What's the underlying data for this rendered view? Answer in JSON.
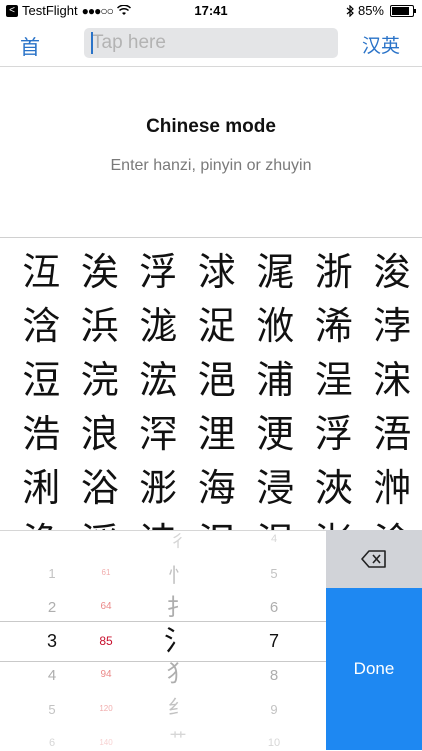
{
  "status_bar": {
    "back_app": "TestFlight",
    "back_glyph": "<",
    "signal": "●●●○○",
    "time": "17:41",
    "battery_text": "85%",
    "battery_level": 0.85
  },
  "nav": {
    "home_label": "首",
    "search_placeholder": "Tap here",
    "lang_label": "汉英"
  },
  "header": {
    "title": "Chinese mode",
    "subtitle": "Enter hanzi, pinyin or zhuyin"
  },
  "char_grid": [
    [
      "沍",
      "涘",
      "浮",
      "浗",
      "浘",
      "浙",
      "浚"
    ],
    [
      "浛",
      "浜",
      "浝",
      "浞",
      "浟",
      "浠",
      "浡"
    ],
    [
      "浢",
      "浣",
      "浤",
      "浥",
      "浦",
      "浧",
      "浨"
    ],
    [
      "浩",
      "浪",
      "浫",
      "浬",
      "浭",
      "浮",
      "浯"
    ],
    [
      "浰",
      "浴",
      "浵",
      "海",
      "浸",
      "浹",
      "浺"
    ],
    [
      "浼",
      "浽",
      "浾",
      "浿",
      "涀",
      "涁",
      "涂"
    ]
  ],
  "picker": {
    "col1": [
      "1",
      "2",
      "3",
      "4",
      "5",
      "6"
    ],
    "col1_selected": "3",
    "col2": [
      "61",
      "64",
      "85",
      "94",
      "120",
      "140"
    ],
    "col2_selected": "85",
    "col3": [
      "彳",
      "忄",
      "扌",
      "氵",
      "犭",
      "纟",
      "艹"
    ],
    "col3_selected": "氵",
    "col4": [
      "4",
      "5",
      "6",
      "7",
      "8",
      "9",
      "10"
    ],
    "col4_selected": "7"
  },
  "keys": {
    "backspace_icon": "backspace-icon",
    "done_label": "Done"
  },
  "colors": {
    "accent": "#2a73c8",
    "done_bg": "#1e88f2",
    "picker_red": "#e04848"
  }
}
